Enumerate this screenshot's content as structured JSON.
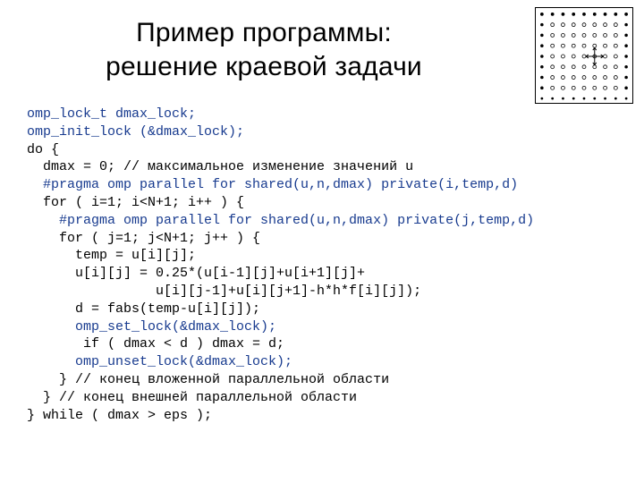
{
  "title": {
    "line1": "Пример программы:",
    "line2": "решение краевой задачи"
  },
  "diagram": {
    "rows": 9,
    "cols": 9,
    "boundary_symbol": "•",
    "interior_symbol": "○",
    "stencil_center": {
      "row": 4,
      "col": 5
    },
    "stencil_neighbors": [
      "up",
      "down",
      "left",
      "right"
    ]
  },
  "code": {
    "l01": "omp_lock_t dmax_lock;",
    "l02": "omp_init_lock (&dmax_lock);",
    "l03": "do {",
    "l04": "  dmax = 0; // максимальное изменение значений u",
    "l05": "  #pragma omp parallel for shared(u,n,dmax) private(i,temp,d)",
    "l06": "  for ( i=1; i<N+1; i++ ) {",
    "l07": "    #pragma omp parallel for shared(u,n,dmax) private(j,temp,d)",
    "l08": "    for ( j=1; j<N+1; j++ ) {",
    "l09": "      temp = u[i][j];",
    "l10": "      u[i][j] = 0.25*(u[i-1][j]+u[i+1][j]+",
    "l11": "                u[i][j-1]+u[i][j+1]-h*h*f[i][j]);",
    "l12": "      d = fabs(temp-u[i][j]);",
    "l13a": "      omp_set_lock(&dmax_lock);",
    "l14": "       if ( dmax < d ) dmax = d;",
    "l15a": "      omp_unset_lock(&dmax_lock);",
    "l16": "    } // конец вложенной параллельной области",
    "l17": "  } // конец внешней параллельной области",
    "l18": "} while ( dmax > eps );"
  }
}
